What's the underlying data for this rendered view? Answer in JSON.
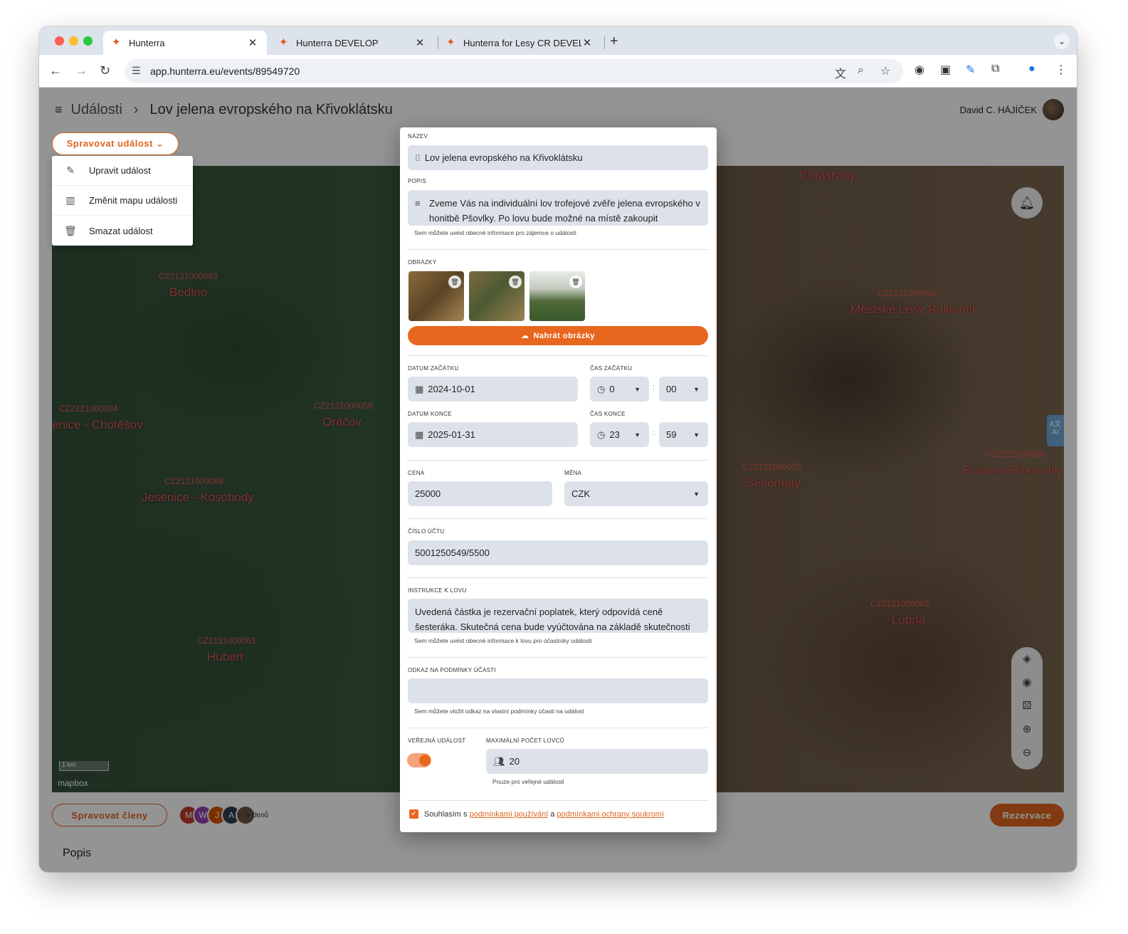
{
  "browser": {
    "tabs": [
      {
        "title": "Hunterra",
        "close": "✕"
      },
      {
        "title": "Hunterra DEVELOP",
        "close": "✕"
      },
      {
        "title": "Hunterra for Lesy CR DEVELOP",
        "close": "✕"
      }
    ],
    "new_tab": "+",
    "url": "app.hunterra.eu/events/89549720"
  },
  "header": {
    "menu_icon": "≡",
    "crumb": "Události",
    "separator": "›",
    "title": "Lov jelena evropského na Křivoklátsku",
    "user": "David C. HÁJÍČEK"
  },
  "manage_button": "Spravovat událost ⌄",
  "manage_menu": [
    {
      "label": "Upravit událost",
      "icon": "edit-icon"
    },
    {
      "label": "Změnit mapu události",
      "icon": "map-icon"
    },
    {
      "label": "Smazat událost",
      "icon": "trash-icon"
    }
  ],
  "map": {
    "labels": [
      {
        "text": "Bedlno"
      },
      {
        "text": "Chrášťany"
      },
      {
        "text": "Městské Lesy Rakovník"
      },
      {
        "text": "enice - Chotěšov"
      },
      {
        "text": "Oráčov"
      },
      {
        "text": "Jesenice - Kosobody"
      },
      {
        "text": "Senomaty"
      },
      {
        "text": "Bulovna Rakovník"
      },
      {
        "text": "Hubert"
      },
      {
        "text": "Lubná"
      }
    ],
    "attribution": "mapbox",
    "scale": "1 km"
  },
  "modal": {
    "name_label": "Název",
    "name_value": "Lov jelena evropského na Křivoklátsku",
    "desc_label": "Popis",
    "desc_value": "Zveme Vás na individuální lov trofejové zvěře jelena evropského v honitbě Pšovlky. Po lovu bude možné na místě zakoupit",
    "desc_hint": "Sem můžete uvést obecné informace pro zájemce o události",
    "images_label": "Obrázky",
    "upload_label": "Nahrát obrázky",
    "start_date_label": "Datum začátku",
    "start_date": "2024-10-01",
    "start_time_label": "Čas začátku",
    "start_hour": "0",
    "start_min": "00",
    "end_date_label": "Datum konce",
    "end_date": "2025-01-31",
    "end_time_label": "Čas konce",
    "end_hour": "23",
    "end_min": "59",
    "time_sep": ":",
    "price_label": "Cena",
    "price": "25000",
    "currency_label": "Měna",
    "currency": "CZK",
    "account_label": "Číslo účtu",
    "account": "5001250549/5500",
    "instr_label": "Instrukce k lovu",
    "instr_value": "Uvedená částka je rezervační poplatek, který odpovídá ceně šesteráka. Skutečná cena bude vyúčtována na základě skutečnosti",
    "instr_hint": "Sem můžete uvést obecné informace k lovu pro účastníky události",
    "terms_label": "Odkaz na podmínky účasti",
    "terms_value": "",
    "terms_hint": "Sem můžete vložit odkaz na vlastní podmínky účasti na událost",
    "public_label": "Veřejná událost",
    "public_on": true,
    "max_label": "Maximální počet lovců",
    "max_value": "20",
    "max_hint": "Pouze pro veřejné události",
    "agree_prefix": "Souhlasím s",
    "agree_link1": "podmínkami používání",
    "agree_mid": "a",
    "agree_link2": "podmínkami ochrany soukromí"
  },
  "footer": {
    "members_button": "Spravovat členy",
    "avatars": [
      "M",
      "W",
      "J",
      "A",
      ""
    ],
    "member_count": "9 členů",
    "reserve_button": "Rezervace",
    "section_title": "Popis"
  },
  "colors": {
    "accent": "#e0651f",
    "field_bg": "#dde2ea"
  }
}
